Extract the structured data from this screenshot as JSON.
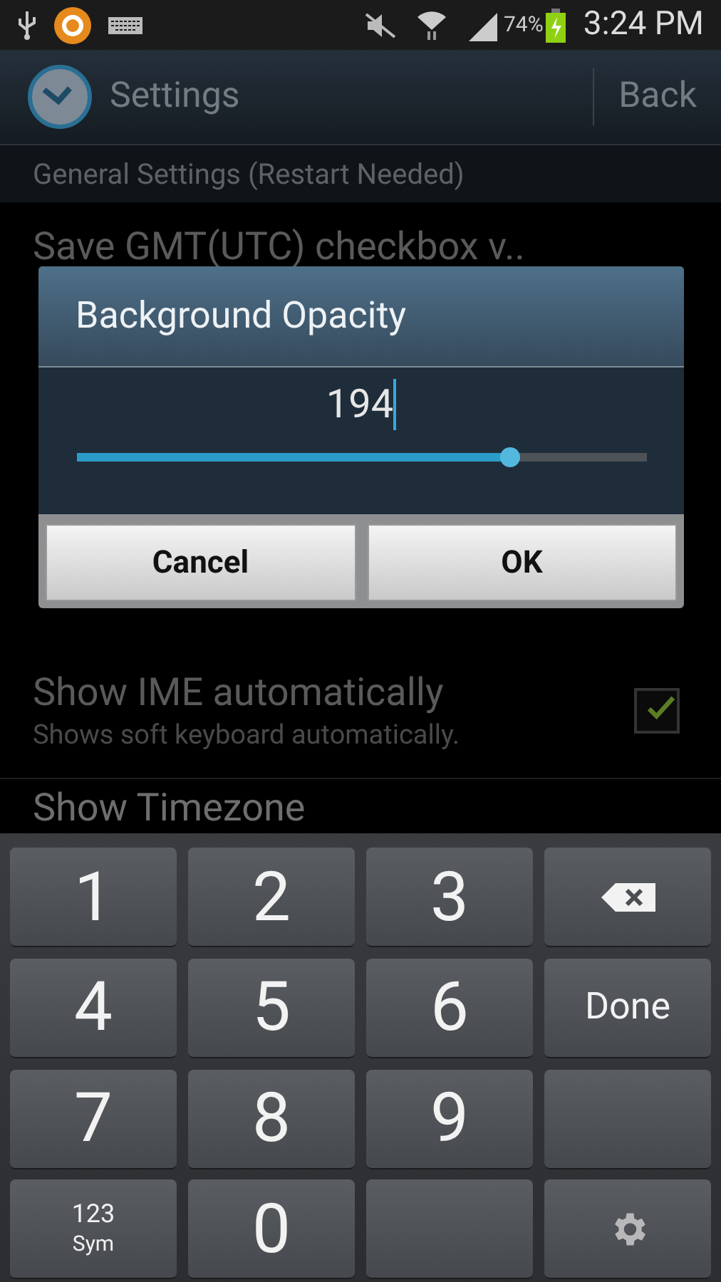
{
  "status_bar": {
    "battery": "74%",
    "time": "3:24 PM"
  },
  "action_bar": {
    "title": "Settings",
    "back": "Back"
  },
  "section_header": "General Settings (Restart Needed)",
  "settings": [
    {
      "title": "Save GMT(UTC) checkbox v.."
    },
    {
      "title": "Show IME automatically",
      "summary": "Shows soft keyboard automatically.",
      "checked": true
    },
    {
      "title": "Show Timezone"
    }
  ],
  "dialog": {
    "title": "Background Opacity",
    "value": "194",
    "level": 0.76,
    "buttons": [
      "Cancel",
      "OK"
    ]
  },
  "keyboard": [
    [
      {
        "kind": "digit",
        "label": "1"
      },
      {
        "kind": "digit",
        "label": "2"
      },
      {
        "kind": "digit",
        "label": "3"
      },
      {
        "kind": "backspace"
      }
    ],
    [
      {
        "kind": "digit",
        "label": "4"
      },
      {
        "kind": "digit",
        "label": "5"
      },
      {
        "kind": "digit",
        "label": "6"
      },
      {
        "kind": "text",
        "label": "Done"
      }
    ],
    [
      {
        "kind": "digit",
        "label": "7"
      },
      {
        "kind": "digit",
        "label": "8"
      },
      {
        "kind": "digit",
        "label": "9"
      },
      {
        "kind": "blank"
      }
    ],
    [
      {
        "kind": "sym",
        "label": "123",
        "sub": "Sym"
      },
      {
        "kind": "digit",
        "label": "0"
      },
      {
        "kind": "blank"
      },
      {
        "kind": "settings"
      }
    ]
  ]
}
